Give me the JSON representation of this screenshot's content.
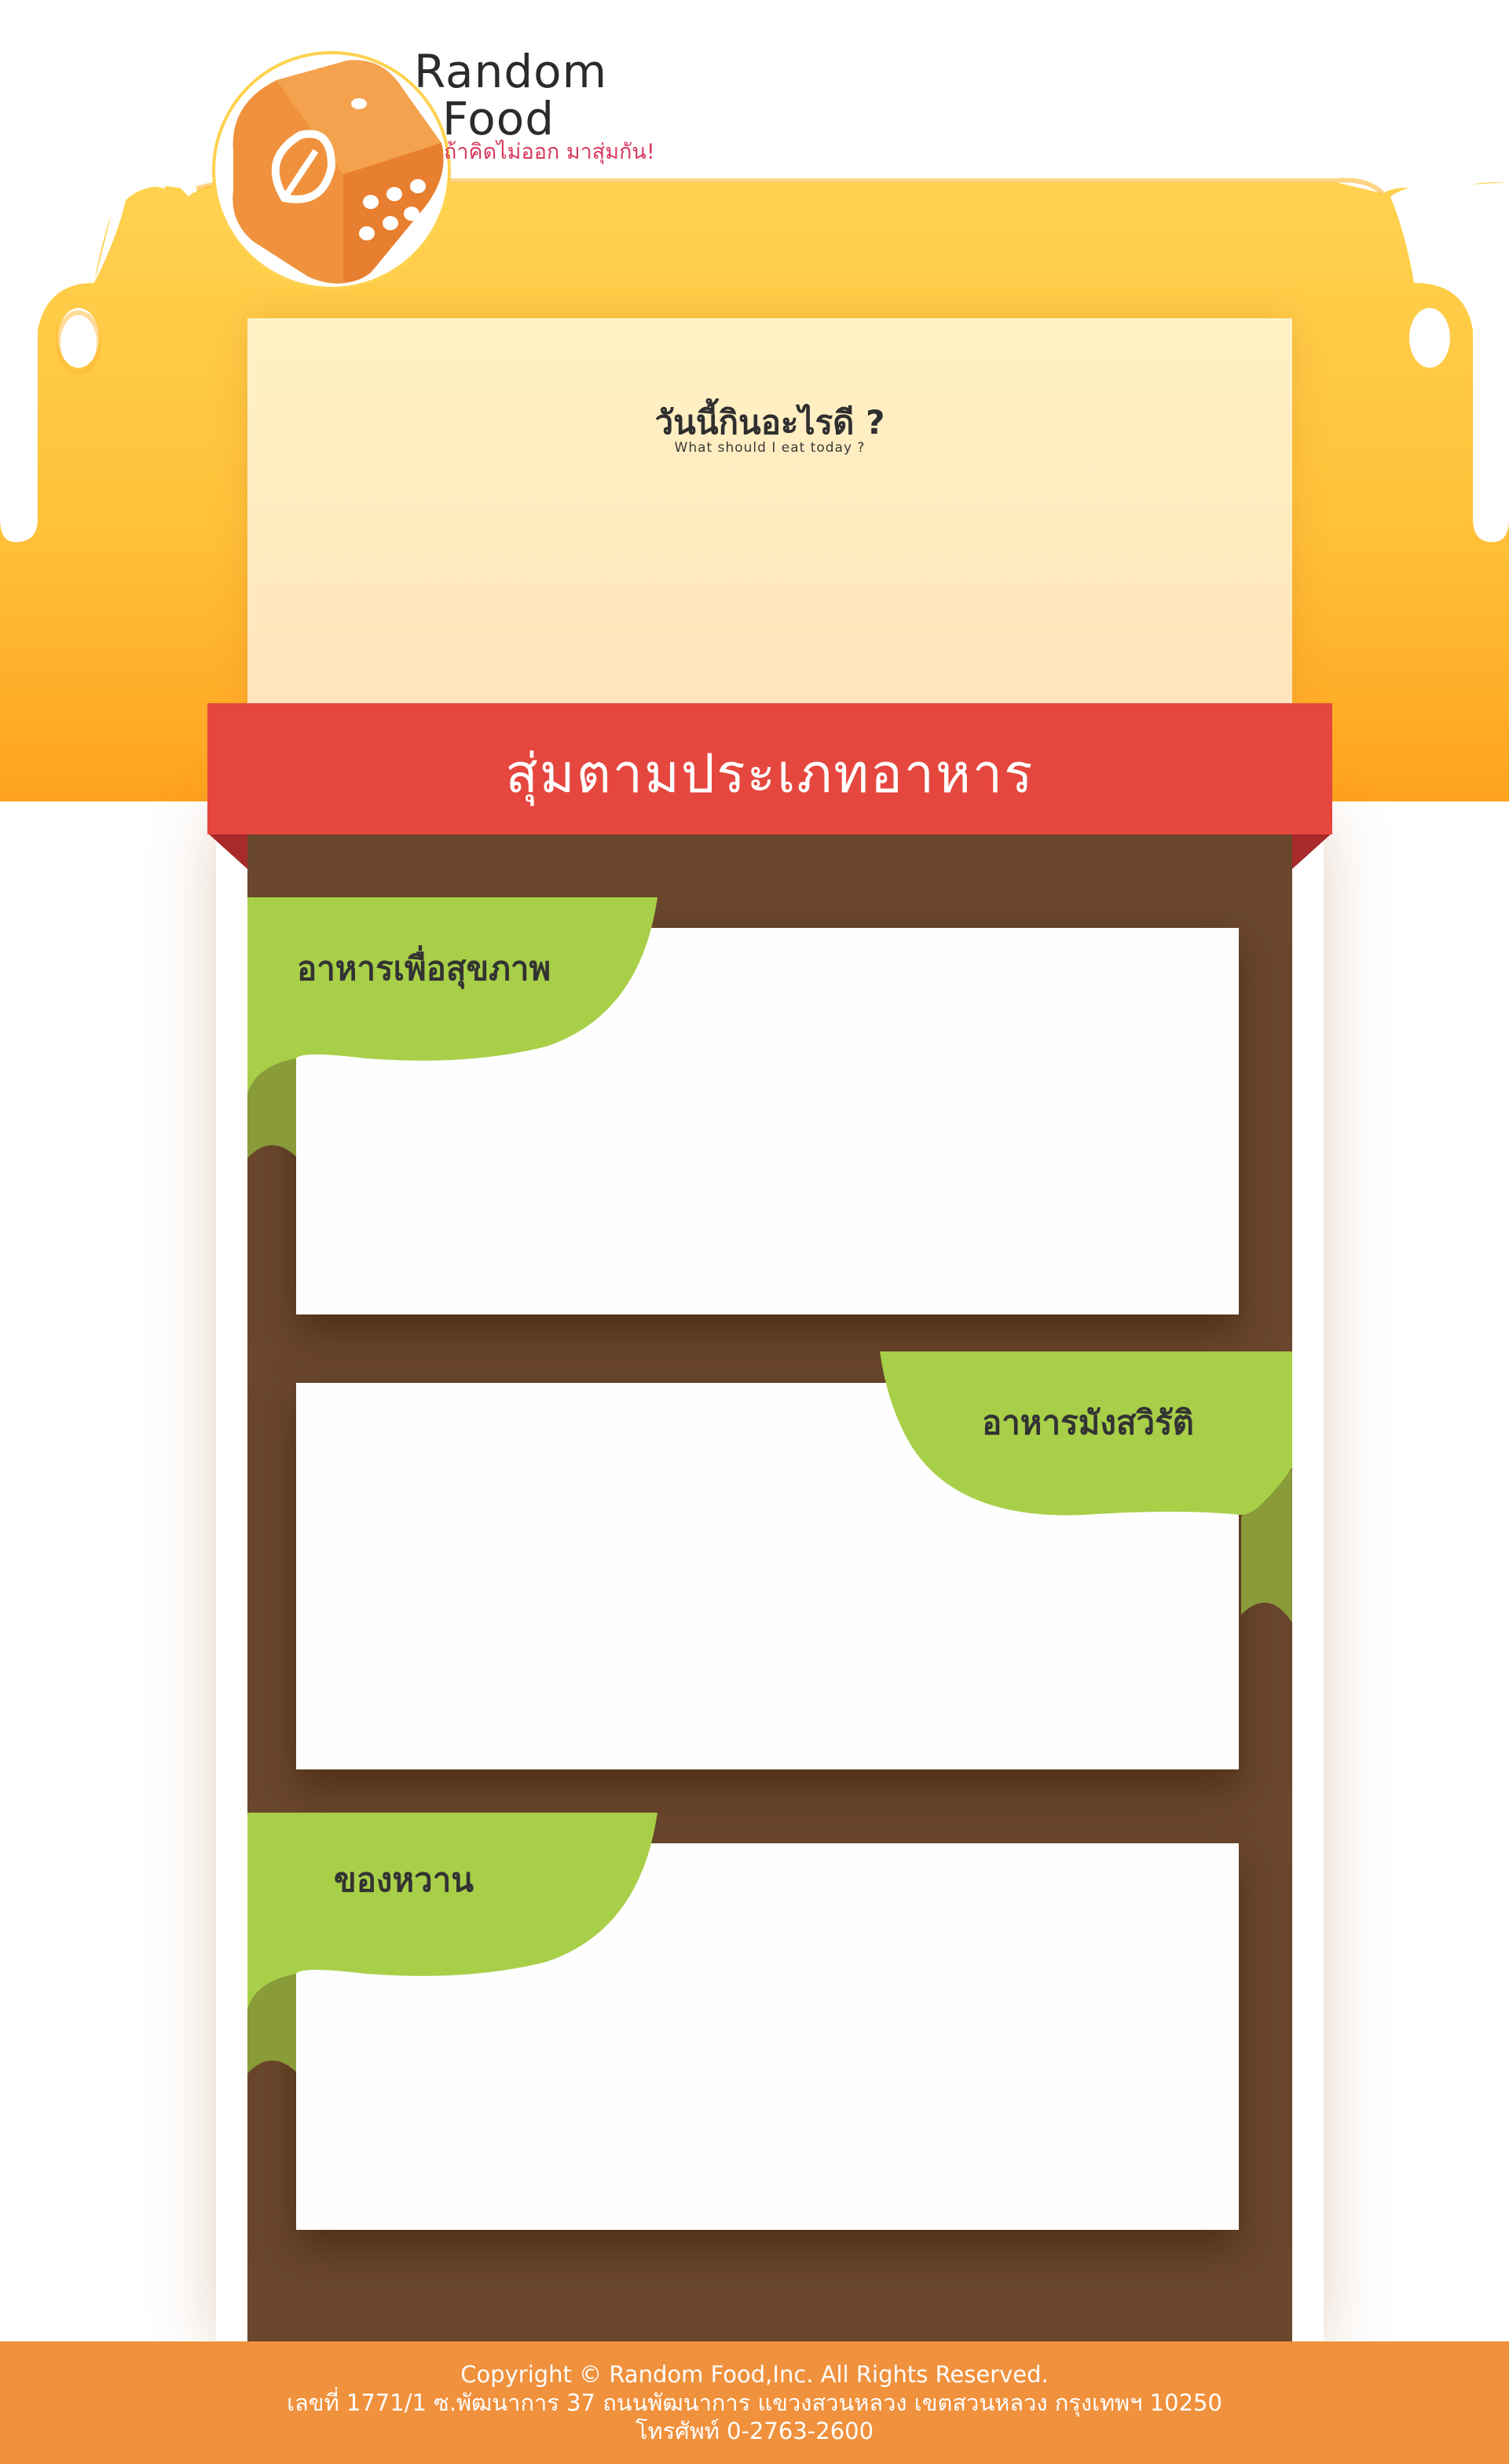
{
  "brand": {
    "name_line1": "Random",
    "name_line2": "Food",
    "tagline": "ถ้าคิดไม่ออก มาสุ่มกัน!"
  },
  "intro": {
    "title": "วันนี้กินอะไรดี ?",
    "subtitle": "What should I eat today ?"
  },
  "section": {
    "heading": "สุ่มตามประเภทอาหาร"
  },
  "categories": [
    {
      "label": "อาหารเพื่อสุขภาพ"
    },
    {
      "label": "อาหารมังสวิรัติ"
    },
    {
      "label": "ของหวาน"
    }
  ],
  "footer": {
    "copyright": "Copyright © Random Food,Inc. All Rights Reserved.",
    "address": "เลขที่ 1771/1 ซ.พัฒนาการ 37 ถนนพัฒนาการ แขวงสวนหลวง เขตสวนหลวง กรุงเทพฯ 10250",
    "phone": "โทรศัพท์ 0-2763-2600"
  },
  "colors": {
    "header_yellow": "#ffd24f",
    "header_orange": "#ffa21e",
    "logo_orange": "#f0913d",
    "ribbon_red": "#e5473f",
    "board_brown": "#6a472c",
    "tag_green": "#a8cf48",
    "footer_orange": "#f0913d",
    "tagline_pink": "#d83a5e"
  },
  "icons": {
    "logo": "dice-logo-icon"
  }
}
